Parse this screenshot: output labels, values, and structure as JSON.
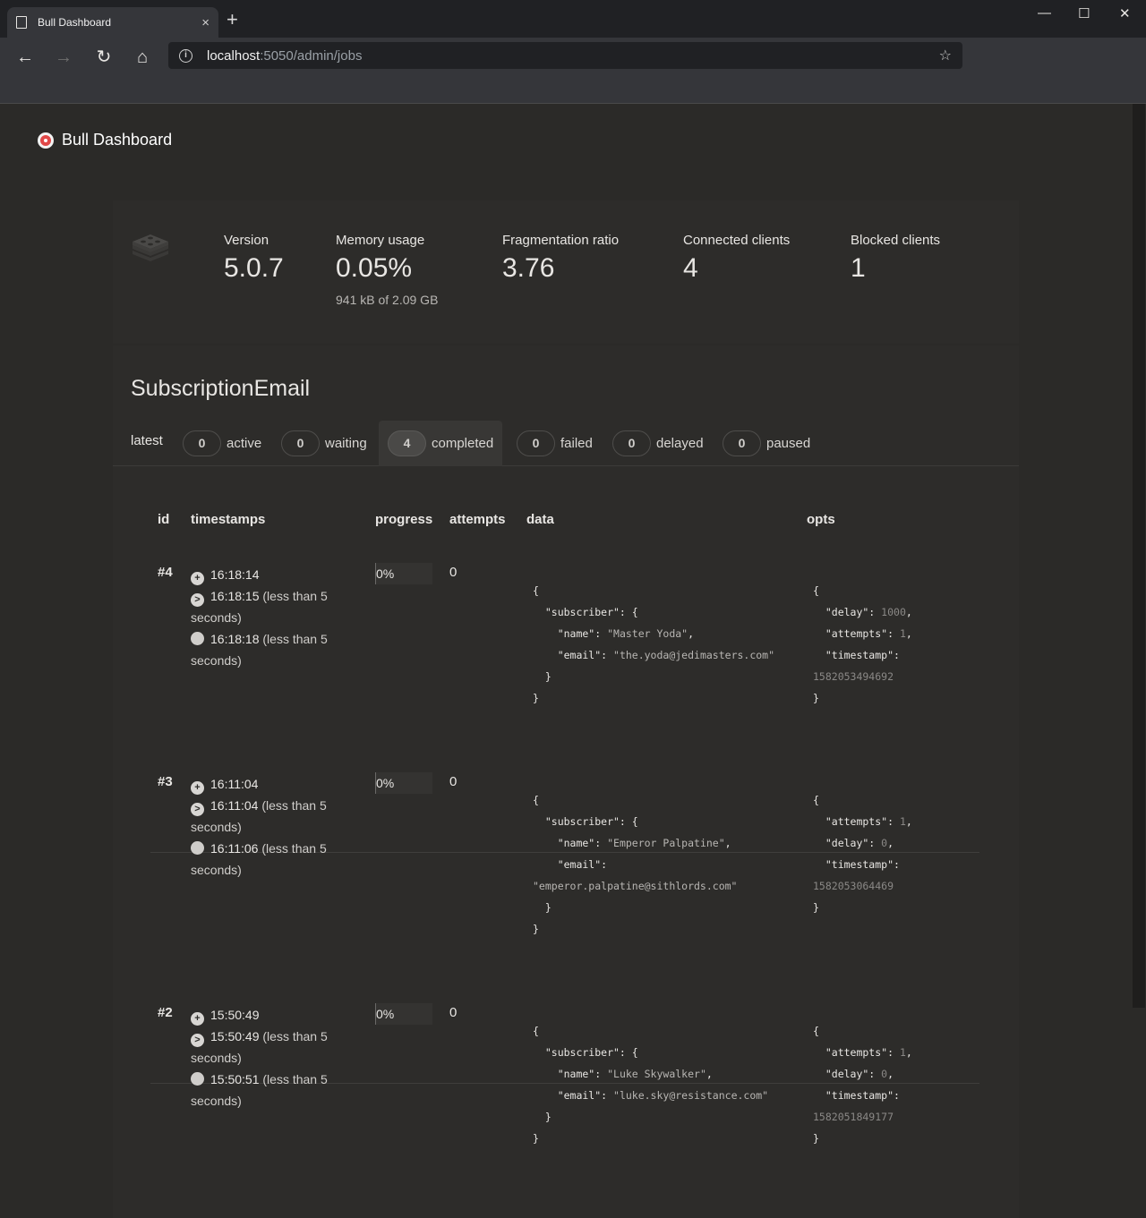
{
  "browser": {
    "tab_title": "Bull Dashboard",
    "tab_close": "×",
    "new_tab": "+",
    "url_host": "localhost",
    "url_path": ":5050/admin/jobs",
    "minimize": "—",
    "maximize": "☐",
    "close": "✕",
    "back": "←",
    "forward": "→",
    "reload": "↻",
    "home": "⌂",
    "bookmark": "☆"
  },
  "app": {
    "title": "Bull Dashboard",
    "logo_icon": "target-icon"
  },
  "stats": {
    "version_label": "Version",
    "version": "5.0.7",
    "memory_label": "Memory usage",
    "memory": "0.05%",
    "memory_detail": "941 kB of 2.09 GB",
    "frag_label": "Fragmentation ratio",
    "frag": "3.76",
    "clients_label": "Connected clients",
    "clients": "4",
    "blocked_label": "Blocked clients",
    "blocked": "1"
  },
  "queue": {
    "name": "SubscriptionEmail",
    "filters": {
      "latest": "latest",
      "items": [
        {
          "count": "0",
          "label": "active"
        },
        {
          "count": "0",
          "label": "waiting"
        },
        {
          "count": "4",
          "label": "completed",
          "selected": true
        },
        {
          "count": "0",
          "label": "failed"
        },
        {
          "count": "0",
          "label": "delayed"
        },
        {
          "count": "0",
          "label": "paused"
        }
      ]
    },
    "columns": {
      "id": "id",
      "timestamps": "timestamps",
      "progress": "progress",
      "attempts": "attempts",
      "data": "data",
      "opts": "opts"
    },
    "jobs": [
      {
        "id": "#4",
        "added": "16:18:14",
        "processed": "16:18:15",
        "processed_note": " (less than 5 seconds)",
        "finished": "16:18:18",
        "finished_note": " (less than 5 seconds)",
        "progress": "0%",
        "attempts": "0",
        "data": {
          "l1": "{",
          "l2": "  \"subscriber\": {",
          "l3k": "    \"name\": ",
          "l3v": "\"Master Yoda\"",
          "l3e": ",",
          "l4k": "    \"email\": ",
          "l4v": "\"the.yoda@jedimasters.com\"",
          "l5": "  }",
          "l6": "}"
        },
        "opts": {
          "l1": "{",
          "l2k": "  \"delay\": ",
          "l2v": "1000",
          "l2e": ",",
          "l3k": "  \"attempts\": ",
          "l3v": "1",
          "l3e": ",",
          "l4k": "  \"timestamp\":",
          "l5v": "1582053494692",
          "l6": "}"
        }
      },
      {
        "id": "#3",
        "added": "16:11:04",
        "processed": "16:11:04",
        "processed_note": " (less than 5 seconds)",
        "finished": "16:11:06",
        "finished_note": " (less than 5 seconds)",
        "progress": "0%",
        "attempts": "0",
        "data": {
          "l1": "{",
          "l2": "  \"subscriber\": {",
          "l3k": "    \"name\": ",
          "l3v": "\"Emperor Palpatine\"",
          "l3e": ",",
          "l4k": "    \"email\":",
          "l4v": "\"emperor.palpatine@sithlords.com\"",
          "l5": "  }",
          "l6": "}"
        },
        "opts": {
          "l1": "{",
          "l2k": "  \"attempts\": ",
          "l2v": "1",
          "l2e": ",",
          "l3k": "  \"delay\": ",
          "l3v": "0",
          "l3e": ",",
          "l4k": "  \"timestamp\":",
          "l5v": "1582053064469",
          "l6": "}"
        }
      },
      {
        "id": "#2",
        "added": "15:50:49",
        "processed": "15:50:49",
        "processed_note": " (less than 5 seconds)",
        "finished": "15:50:51",
        "finished_note": " (less than 5 seconds)",
        "progress": "0%",
        "attempts": "0",
        "data": {
          "l1": "{",
          "l2": "  \"subscriber\": {",
          "l3k": "    \"name\": ",
          "l3v": "\"Luke Skywalker\"",
          "l3e": ",",
          "l4k": "    \"email\": ",
          "l4v": "\"luke.sky@resistance.com\"",
          "l5": "  }",
          "l6": "}"
        },
        "opts": {
          "l1": "{",
          "l2k": "  \"attempts\": ",
          "l2v": "1",
          "l2e": ",",
          "l3k": "  \"delay\": ",
          "l3v": "0",
          "l3e": ",",
          "l4k": "  \"timestamp\":",
          "l5v": "1582051849177",
          "l6": "}"
        }
      }
    ]
  }
}
